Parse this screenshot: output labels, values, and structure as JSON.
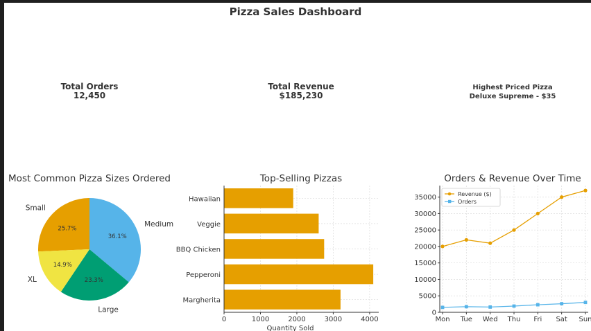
{
  "dashboard": {
    "title": "Pizza Sales Dashboard",
    "kpis": [
      {
        "label": "Total Orders",
        "value": "12,450"
      },
      {
        "label": "Total Revenue",
        "value": "$185,230"
      },
      {
        "label": "Highest Priced Pizza",
        "value": "Deluxe Supreme - $35"
      }
    ]
  },
  "colors": {
    "orange": "#e69f00",
    "blue": "#56b4e9",
    "green": "#009e73",
    "yellow": "#f0e442"
  },
  "chart_data": [
    {
      "type": "pie",
      "title": "Most Common Pizza Sizes Ordered",
      "categories": [
        "Small",
        "Medium",
        "Large",
        "XL"
      ],
      "values": [
        25.7,
        36.1,
        23.3,
        14.9
      ],
      "labels": [
        "25.7%",
        "36.1%",
        "23.3%",
        "14.9%"
      ],
      "colors": [
        "#e69f00",
        "#56b4e9",
        "#009e73",
        "#f0e442"
      ]
    },
    {
      "type": "bar",
      "orientation": "horizontal",
      "title": "Top-Selling Pizzas",
      "categories": [
        "Margherita",
        "Pepperoni",
        "BBQ Chicken",
        "Veggie",
        "Hawaiian"
      ],
      "values": [
        3200,
        4100,
        2750,
        2600,
        1900
      ],
      "xlabel": "Quantity Sold",
      "xlim": [
        0,
        4250
      ],
      "xticks": [
        0,
        1000,
        2000,
        3000,
        4000
      ],
      "grid": true,
      "color": "#e69f00"
    },
    {
      "type": "line",
      "title": "Orders & Revenue Over Time",
      "x": [
        "Mon",
        "Tue",
        "Wed",
        "Thu",
        "Fri",
        "Sat",
        "Sun"
      ],
      "series": [
        {
          "name": "Revenue ($)",
          "values": [
            20000,
            22000,
            21000,
            25000,
            30000,
            35000,
            37000
          ],
          "color": "#e69f00",
          "marker": "circle"
        },
        {
          "name": "Orders",
          "values": [
            1500,
            1700,
            1600,
            1900,
            2300,
            2600,
            3000
          ],
          "color": "#56b4e9",
          "marker": "square"
        }
      ],
      "ylim": [
        0,
        38500
      ],
      "yticks": [
        0,
        5000,
        10000,
        15000,
        20000,
        25000,
        30000,
        35000
      ],
      "grid": true,
      "legend": "top-left"
    }
  ]
}
